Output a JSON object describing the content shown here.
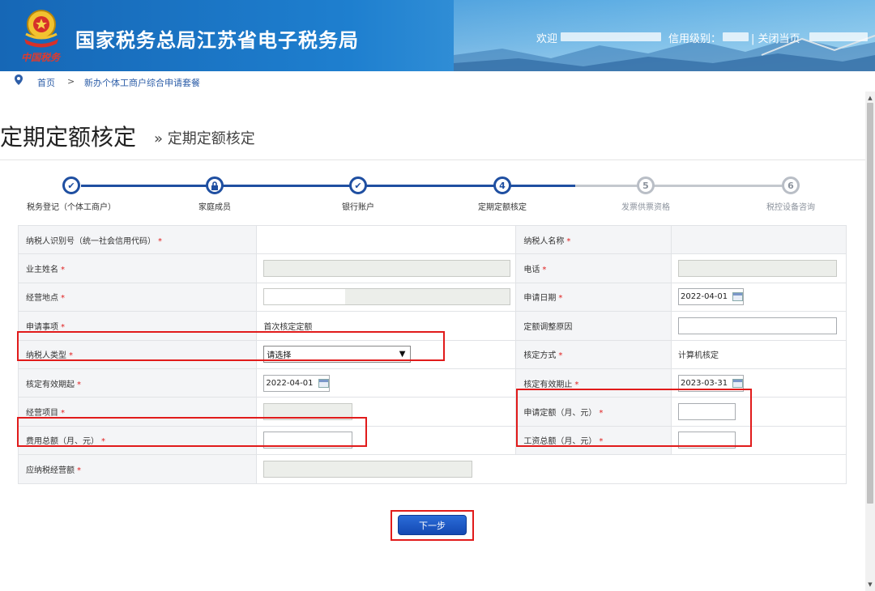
{
  "header": {
    "brand_text": "中国税务",
    "site_title": "国家税务总局江苏省电子税务局",
    "welcome": "欢迎",
    "credit_level": "信用级别：",
    "close_page": "| 关闭当页"
  },
  "breadcrumb": {
    "home": "首页",
    "separator": ">",
    "current": "新办个体工商户综合申请套餐"
  },
  "page": {
    "title": "定期定额核定",
    "subtitle": "» 定期定额核定"
  },
  "steps": [
    {
      "label": "税务登记（个体工商户）",
      "state": "done",
      "glyph": "✔"
    },
    {
      "label": "家庭成员",
      "state": "locked",
      "glyph": "🔒"
    },
    {
      "label": "银行账户",
      "state": "done",
      "glyph": "✔"
    },
    {
      "label": "定期定额核定",
      "state": "current",
      "glyph": "4"
    },
    {
      "label": "发票供票资格",
      "state": "pending",
      "glyph": "5"
    },
    {
      "label": "税控设备咨询",
      "state": "pending",
      "glyph": "6"
    }
  ],
  "form": {
    "taxpayer_id_label": "纳税人识别号（统一社会信用代码）",
    "taxpayer_name_label": "纳税人名称",
    "owner_name_label": "业主姓名",
    "phone_label": "电话",
    "address_label": "经营地点",
    "apply_date_label": "申请日期",
    "apply_date_value": "2022-04-01",
    "apply_item_label": "申请事项",
    "apply_item_value": "首次核定定额",
    "adjust_reason_label": "定额调整原因",
    "taxpayer_type_label": "纳税人类型",
    "taxpayer_type_value": "请选择",
    "assess_method_label": "核定方式",
    "assess_method_value": "计算机核定",
    "valid_from_label": "核定有效期起",
    "valid_from_value": "2022-04-01",
    "valid_to_label": "核定有效期止",
    "valid_to_value": "2023-03-31",
    "business_item_label": "经营项目",
    "apply_quota_label": "申请定额（月、元）",
    "expense_total_label": "费用总额（月、元）",
    "wage_total_label": "工资总额（月、元）",
    "taxable_amount_label": "应纳税经营额",
    "required_mark": "*"
  },
  "buttons": {
    "next": "下一步"
  },
  "colors": {
    "primary": "#1f4fa1",
    "highlight": "#e11b1b",
    "required": "#e02020"
  }
}
